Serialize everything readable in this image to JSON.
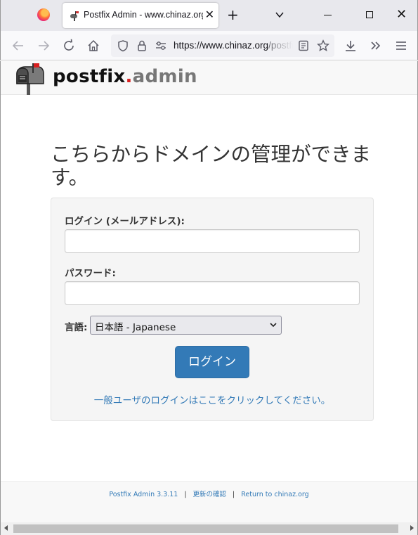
{
  "browser": {
    "tab_title": "Postfix Admin - www.chinaz.org",
    "close_tab_glyph": "✕",
    "new_tab_glyph": "+",
    "url_host": "https://www.chinaz.org",
    "url_rest": "/postfixadmin/login.php",
    "window_close_glyph": "✕",
    "icons": [
      "firefox-icon",
      "back-icon",
      "forward-icon",
      "reload-icon",
      "home-icon",
      "shield-icon",
      "lock-icon",
      "permissions-icon",
      "reader-view-icon",
      "star-icon",
      "download-icon",
      "overflow-icon",
      "menu-icon"
    ]
  },
  "header": {
    "logo_part1": "postfix",
    "logo_dot": ".",
    "logo_part2": "admin"
  },
  "main": {
    "headline": "こちらからドメインの管理ができます。",
    "login_label": "ログイン (メールアドレス):",
    "login_value": "",
    "password_label": "パスワード:",
    "password_value": "",
    "language_label": "言語:",
    "language_selected": "日本語 - Japanese",
    "login_button": "ログイン",
    "user_login_link": "一般ユーザのログインはここをクリックしてください。"
  },
  "footer": {
    "version": "Postfix Admin 3.3.11",
    "separator": "|",
    "check_updates": "更新の確認",
    "return_link": "Return to chinaz.org"
  },
  "colors": {
    "primary": "#337ab7",
    "logo_dot": "#d81f1f"
  }
}
